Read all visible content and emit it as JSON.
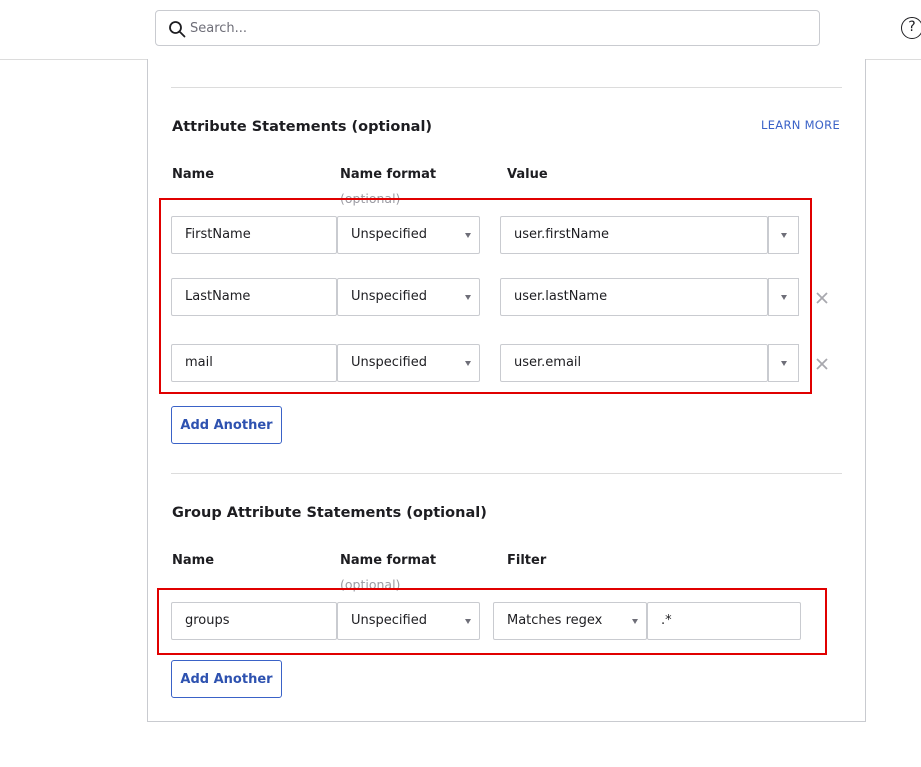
{
  "search": {
    "placeholder": "Search..."
  },
  "header": {
    "help_label": "?"
  },
  "attribute_statements": {
    "title": "Attribute Statements (optional)",
    "learn_more": "LEARN MORE",
    "columns": {
      "name": "Name",
      "name_format": "Name format",
      "name_format_sub": "(optional)",
      "value": "Value"
    },
    "rows": [
      {
        "name": "FirstName",
        "format": "Unspecified",
        "value": "user.firstName"
      },
      {
        "name": "LastName",
        "format": "Unspecified",
        "value": "user.lastName"
      },
      {
        "name": "mail",
        "format": "Unspecified",
        "value": "user.email"
      }
    ],
    "add_button": "Add Another"
  },
  "group_attribute_statements": {
    "title": "Group Attribute Statements (optional)",
    "columns": {
      "name": "Name",
      "name_format": "Name format",
      "name_format_sub": "(optional)",
      "filter": "Filter"
    },
    "rows": [
      {
        "name": "groups",
        "format": "Unspecified",
        "filter_type": "Matches regex",
        "filter_value": ".*"
      }
    ],
    "add_button": "Add Another"
  },
  "colors": {
    "accent": "#3a62c7",
    "highlight": "#e00000",
    "border": "#c9cbd0"
  }
}
